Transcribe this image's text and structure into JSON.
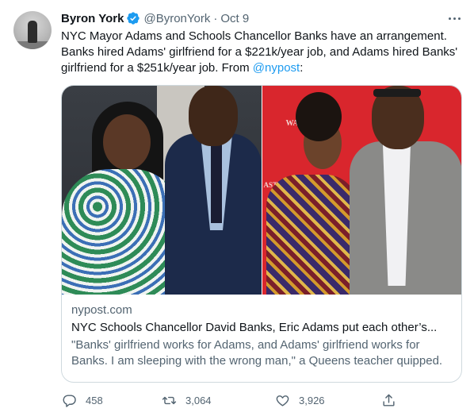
{
  "author": {
    "name": "Byron York",
    "handle": "@ByronYork",
    "separator": "·",
    "time": "Oct 9",
    "verified": true
  },
  "tweet": {
    "lines": [
      "NYC Mayor Adams and Schools Chancellor Banks have an arrangement.",
      "Banks hired Adams' girlfriend for a $221k/year job, and Adams hired Banks'"
    ],
    "line3_prefix": "girlfriend for a $251k/year job. From ",
    "mention": "@nypost",
    "line3_suffix": ":"
  },
  "card": {
    "domain": "nypost.com",
    "title": "NYC Schools Chancellor David Banks, Eric Adams put each other’s...",
    "description_lines": [
      "\"Banks' girlfriend works for Adams, and Adams' girlfriend works for",
      "Banks. I am sleeping with the wrong man,\" a Queens teacher quipped."
    ],
    "image_text": {
      "banner_top": "WASH",
      "banner_mid": "ASTON"
    }
  },
  "actions": {
    "reply_count": "458",
    "retweet_count": "3,064",
    "like_count": "3,926"
  },
  "icons": {
    "verified": "verified-badge-icon",
    "more": "more-icon",
    "reply": "reply-icon",
    "retweet": "retweet-icon",
    "like": "heart-icon",
    "share": "share-icon"
  },
  "colors": {
    "text": "#0f1419",
    "secondary": "#536471",
    "link": "#1d9bf0",
    "border": "#cfd9de"
  }
}
